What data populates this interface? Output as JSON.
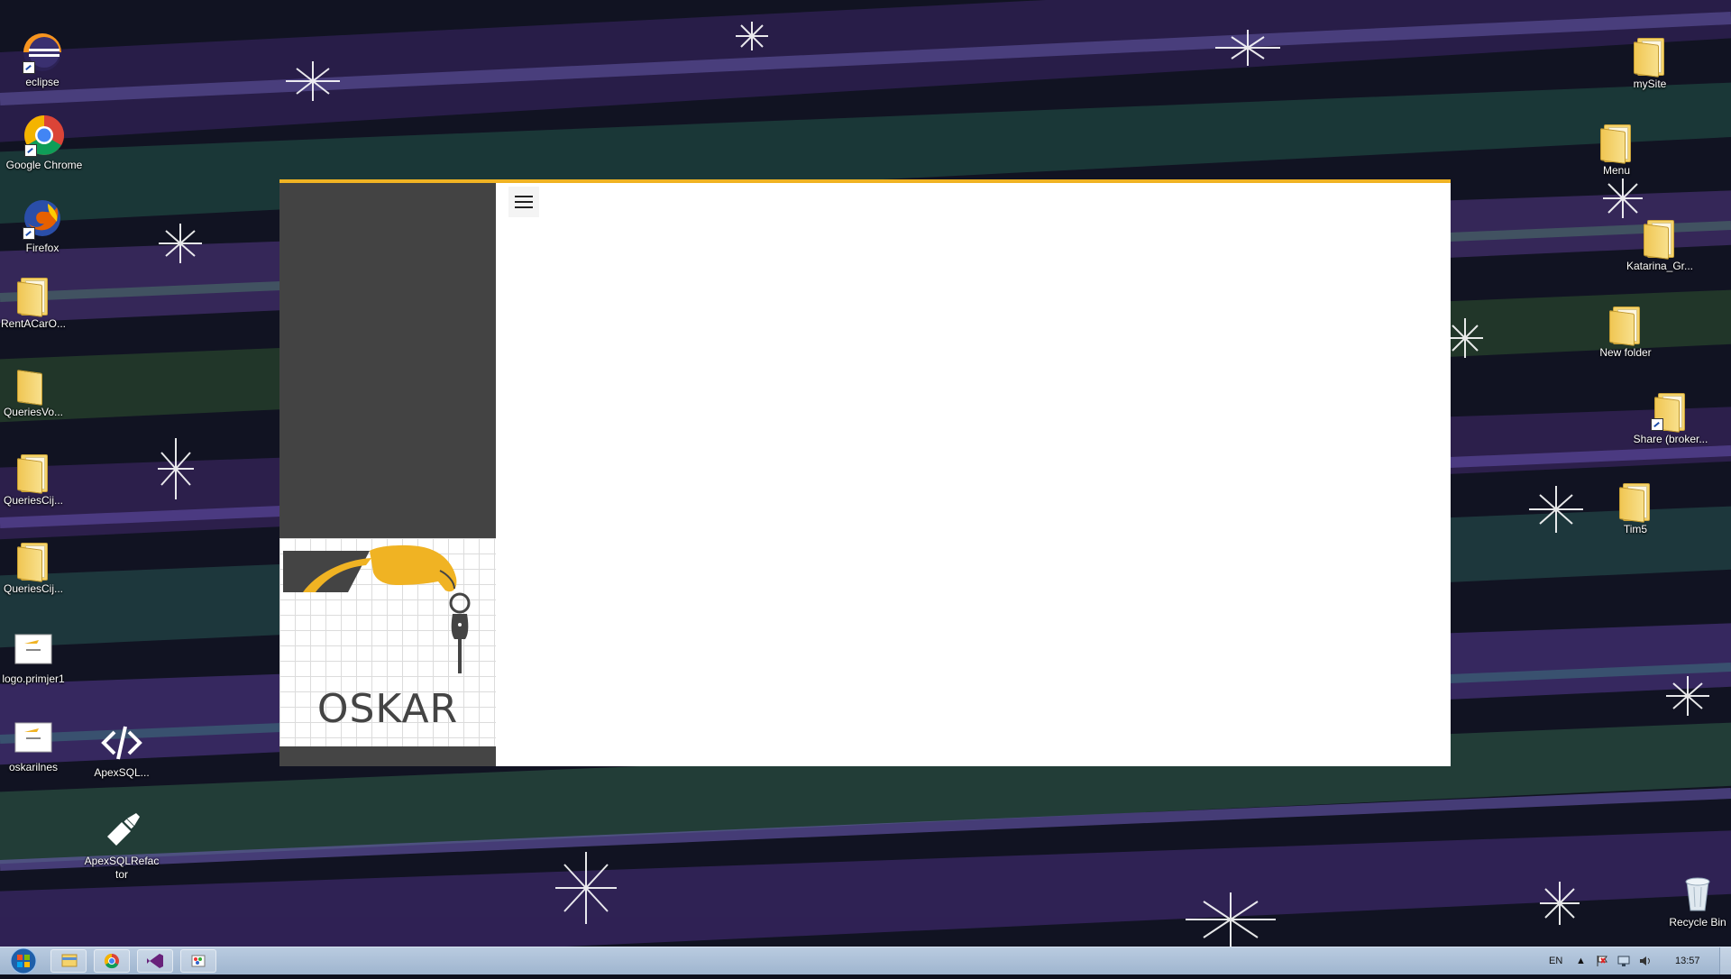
{
  "desktop": {
    "left_icons": [
      {
        "label": "eclipse",
        "icon": "eclipse-icon"
      },
      {
        "label": "Google Chrome",
        "icon": "chrome-icon"
      },
      {
        "label": "Firefox",
        "icon": "firefox-icon"
      },
      {
        "label": "RentACarO...",
        "icon": "folder-icon"
      },
      {
        "label": "QueriesVo...",
        "icon": "folder-icon"
      },
      {
        "label": "QueriesCij...",
        "icon": "folder-icon"
      },
      {
        "label": "QueriesCij...",
        "icon": "folder-icon"
      },
      {
        "label": "logo.primjer1",
        "icon": "image-file-icon"
      },
      {
        "label": "oskarilnes",
        "icon": "image-file-icon"
      },
      {
        "label": "ApexSQL...",
        "icon": "apexsql-icon"
      },
      {
        "label": "ApexSQLRefactor",
        "icon": "apexsql-refactor-icon"
      }
    ],
    "right_icons": [
      {
        "label": "mySite",
        "icon": "folder-icon"
      },
      {
        "label": "Menu",
        "icon": "folder-icon"
      },
      {
        "label": "Katarina_Gr...",
        "icon": "folder-icon"
      },
      {
        "label": "New folder",
        "icon": "folder-icon"
      },
      {
        "label": "Share (broker...",
        "icon": "shared-folder-icon"
      },
      {
        "label": "Tim5",
        "icon": "folder-icon"
      },
      {
        "label": "Recycle Bin",
        "icon": "recycle-bin-icon"
      }
    ]
  },
  "app": {
    "logo_text": "OSKAR",
    "accent_color": "#f0b323",
    "sidebar_color": "#444444",
    "menu_button_icon": "hamburger-menu-icon"
  },
  "taskbar": {
    "pinned": [
      {
        "name": "File Explorer",
        "icon": "file-explorer-icon"
      },
      {
        "name": "Google Chrome",
        "icon": "chrome-icon"
      },
      {
        "name": "Visual Studio",
        "icon": "visual-studio-icon"
      },
      {
        "name": "Paint",
        "icon": "paint-icon"
      }
    ],
    "language": "EN",
    "clock": "13:57"
  }
}
